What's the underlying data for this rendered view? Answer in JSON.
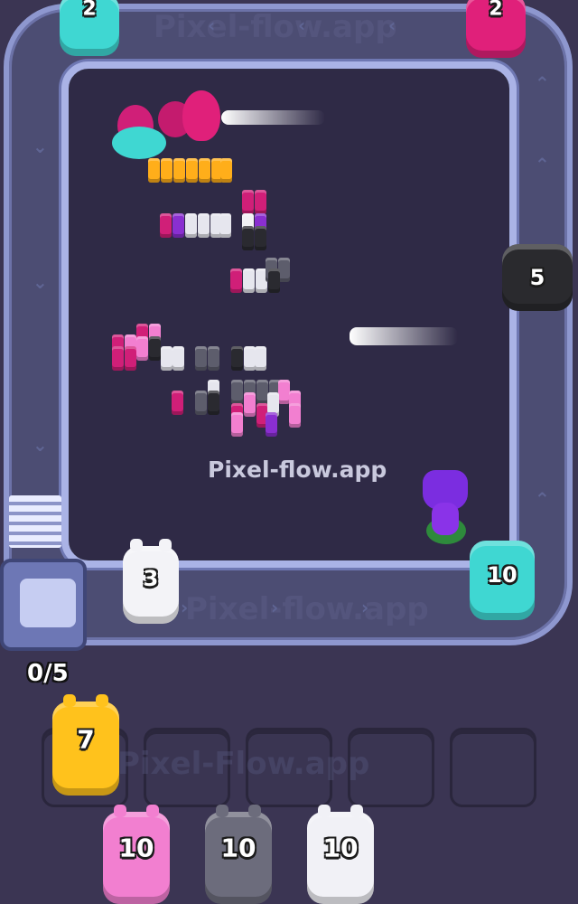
{
  "watermarks": {
    "top": "Pixel-flow.app",
    "center": "Pixel-flow.app",
    "track_bottom": "Pixel-flow.app",
    "queue": "Pixel-Flow.app"
  },
  "conveyor_pigs": [
    {
      "id": "cyan-top",
      "count": "2",
      "color": "#3fd7d2"
    },
    {
      "id": "magenta-top",
      "count": "2",
      "color": "#e0207a"
    },
    {
      "id": "black-right",
      "count": "5",
      "color": "#2a2a2e"
    },
    {
      "id": "cyan-right",
      "count": "10",
      "color": "#3fd7d2"
    },
    {
      "id": "white-bottom",
      "count": "3",
      "color": "#f3f3f7"
    }
  ],
  "counter": {
    "label": "0/5"
  },
  "slots": [
    {
      "count": "7",
      "color": "#ffc21c"
    },
    {
      "count": "",
      "color": ""
    },
    {
      "count": "",
      "color": ""
    },
    {
      "count": "",
      "color": ""
    },
    {
      "count": "",
      "color": ""
    }
  ],
  "queue_pigs": [
    {
      "count": "10",
      "color": "#f27fd0"
    },
    {
      "count": "10",
      "color": "#6c6c7c"
    },
    {
      "count": "10",
      "color": "#f1f1f6"
    }
  ]
}
